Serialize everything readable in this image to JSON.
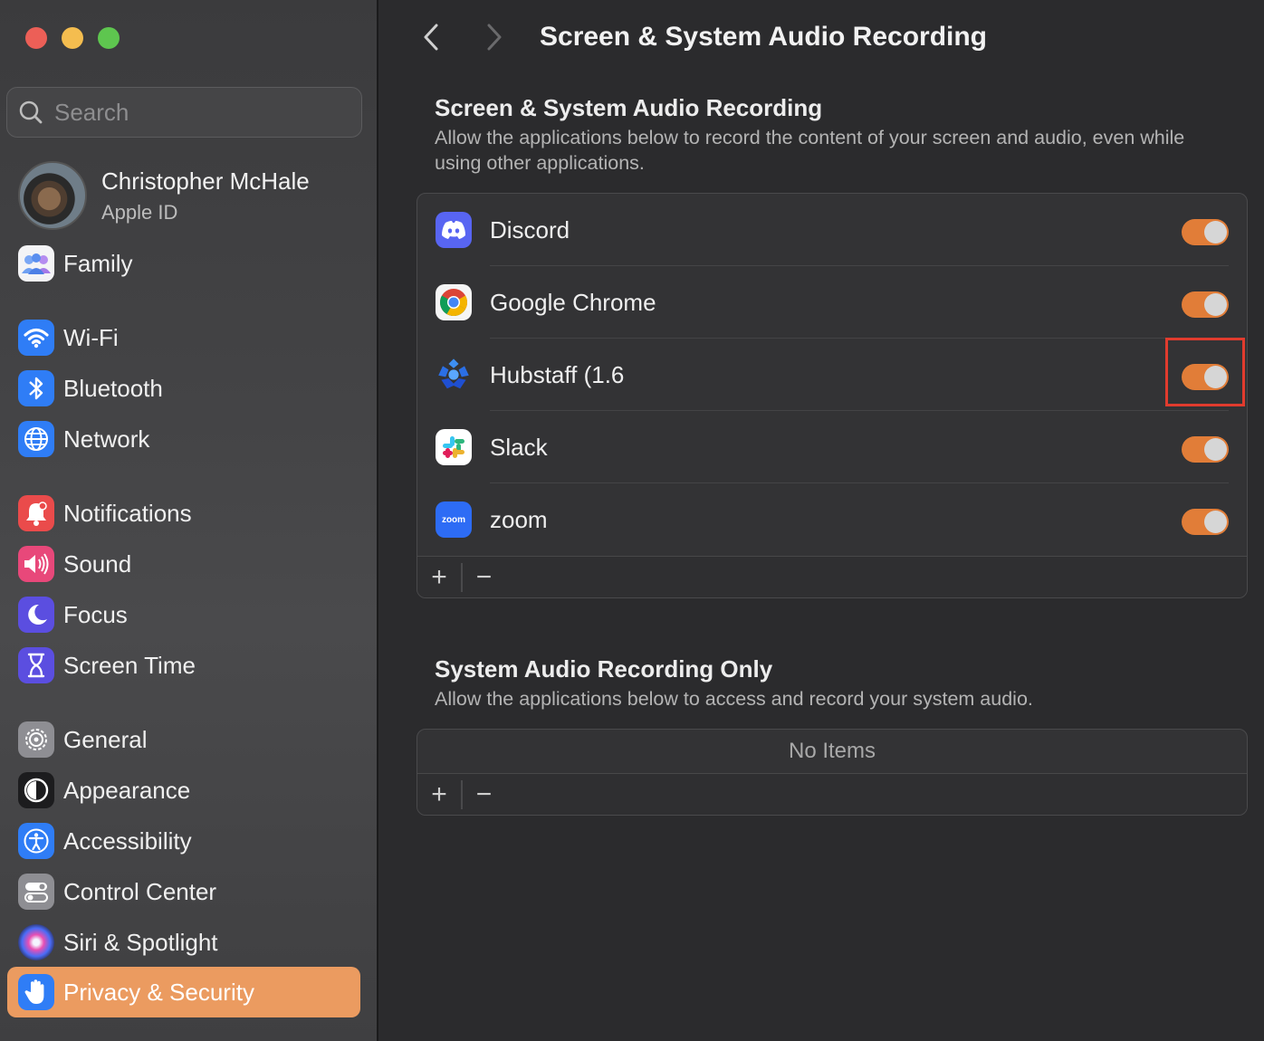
{
  "window": {
    "title": "Screen & System Audio Recording"
  },
  "sidebar": {
    "search_placeholder": "Search",
    "profile": {
      "name": "Christopher McHale",
      "subtitle": "Apple ID"
    },
    "items": [
      {
        "label": "Family",
        "icon": "family-icon"
      },
      {
        "label": "Wi-Fi",
        "icon": "wifi-icon"
      },
      {
        "label": "Bluetooth",
        "icon": "bluetooth-icon"
      },
      {
        "label": "Network",
        "icon": "network-globe-icon"
      },
      {
        "label": "Notifications",
        "icon": "notifications-bell-icon"
      },
      {
        "label": "Sound",
        "icon": "speaker-icon"
      },
      {
        "label": "Focus",
        "icon": "moon-icon"
      },
      {
        "label": "Screen Time",
        "icon": "hourglass-icon"
      },
      {
        "label": "General",
        "icon": "gear-icon"
      },
      {
        "label": "Appearance",
        "icon": "appearance-icon"
      },
      {
        "label": "Accessibility",
        "icon": "accessibility-icon"
      },
      {
        "label": "Control Center",
        "icon": "control-center-icon"
      },
      {
        "label": "Siri & Spotlight",
        "icon": "siri-icon"
      },
      {
        "label": "Privacy & Security",
        "icon": "hand-icon",
        "active": true
      }
    ]
  },
  "main": {
    "section1": {
      "title": "Screen & System Audio Recording",
      "description": "Allow the applications below to record the content of your screen and audio, even while using other applications.",
      "apps": [
        {
          "name": "Discord",
          "icon": "discord-icon",
          "enabled": true
        },
        {
          "name": "Google Chrome",
          "icon": "chrome-icon",
          "enabled": true
        },
        {
          "name": "Hubstaff (1.6",
          "icon": "hubstaff-icon",
          "enabled": true,
          "highlighted": true
        },
        {
          "name": "Slack",
          "icon": "slack-icon",
          "enabled": true
        },
        {
          "name": "zoom",
          "icon": "zoom-icon",
          "enabled": true
        }
      ]
    },
    "section2": {
      "title": "System Audio Recording Only",
      "description": "Allow the applications below to access and record your system audio.",
      "empty_text": "No Items"
    },
    "footer_add": "+",
    "footer_remove": "−",
    "zoom_icon_text": "zoom"
  },
  "colors": {
    "accent": "#eb9b60",
    "toggle_on": "#e17d38",
    "highlight_box": "#e13b2e"
  }
}
